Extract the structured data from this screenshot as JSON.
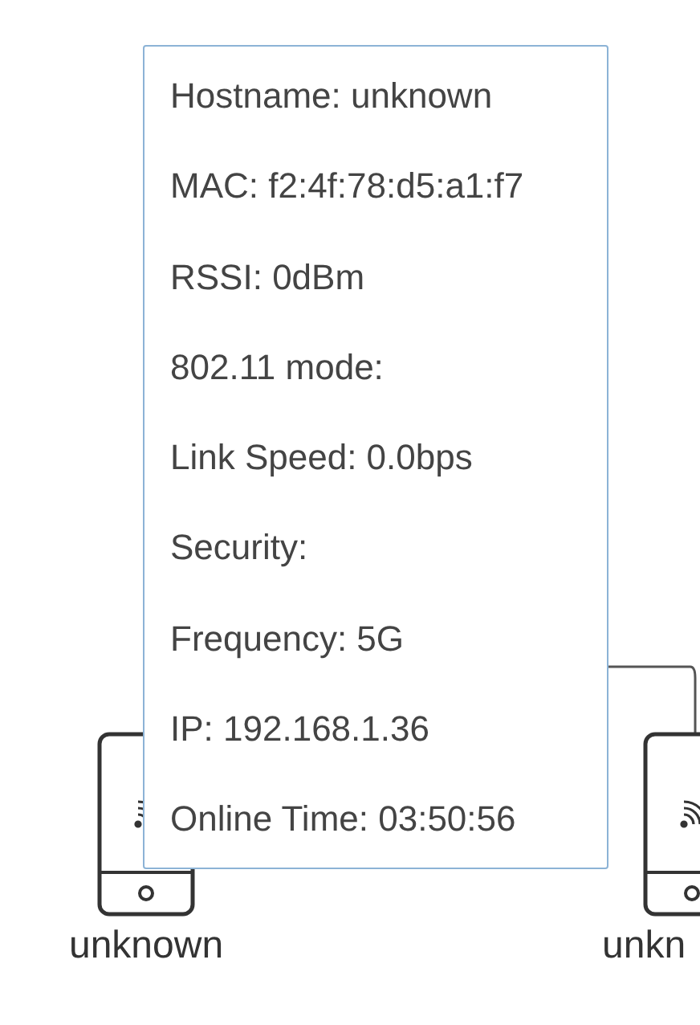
{
  "devices": [
    {
      "label": "unknown"
    },
    {
      "label": "unkn"
    }
  ],
  "tooltip": {
    "lines": [
      "Hostname: unknown",
      "MAC: f2:4f:78:d5:a1:f7",
      "RSSI: 0dBm",
      "802.11 mode:",
      "Link Speed: 0.0bps",
      "Security:",
      "Frequency: 5G",
      "IP: 192.168.1.36",
      "Online Time: 03:50:56"
    ]
  }
}
